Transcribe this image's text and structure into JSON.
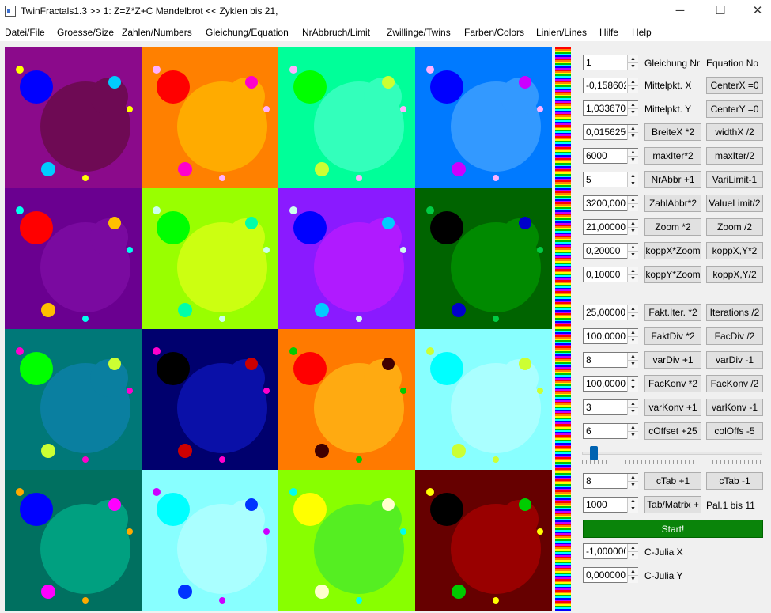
{
  "window": {
    "title": "TwinFractals1.3 >> 1: Z=Z*Z+C Mandelbrot << Zyklen bis 21,",
    "minimize_glyph": "─",
    "maximize_glyph": "☐",
    "close_glyph": "✕"
  },
  "menu": [
    "Datei/File",
    "Groesse/Size",
    "Zahlen/Numbers",
    "Gleichung/Equation",
    "NrAbbruch/Limit",
    "Zwillinge/Twins",
    "Farben/Colors",
    "Linien/Lines",
    "Hilfe",
    "Help"
  ],
  "tiles": [
    {
      "bg": "#8b0a8b",
      "body": "#6e0a54",
      "big": "#0000ff",
      "c1": "#ffff00",
      "c2": "#00ccff",
      "c3": "#00ccff",
      "c4": "#ffff00"
    },
    {
      "bg": "#ff8000",
      "body": "#ffab00",
      "big": "#ff0000",
      "c1": "#ffb0ff",
      "c2": "#ff00cc",
      "c3": "#ff00cc",
      "c4": "#ffb0ff"
    },
    {
      "bg": "#00ff99",
      "body": "#33ffbb",
      "big": "#00ff00",
      "c1": "#ffb0ff",
      "c2": "#ccff33",
      "c3": "#ccff33",
      "c4": "#ffb0ff"
    },
    {
      "bg": "#007aff",
      "body": "#3399ff",
      "big": "#0000ff",
      "c1": "#ffb0ff",
      "c2": "#cc00ff",
      "c3": "#cc00ff",
      "c4": "#ffb0ff"
    },
    {
      "bg": "#6a0090",
      "body": "#7a0aa0",
      "big": "#ff0000",
      "c1": "#00ffee",
      "c2": "#ffbf00",
      "c3": "#ffbf00",
      "c4": "#00ffee"
    },
    {
      "bg": "#99ff00",
      "body": "#ccff11",
      "big": "#00ff00",
      "c1": "#ccffee",
      "c2": "#00ffaa",
      "c3": "#00ffaa",
      "c4": "#ccffee"
    },
    {
      "bg": "#8a1aff",
      "body": "#b01aff",
      "big": "#0000ff",
      "c1": "#ccffee",
      "c2": "#00ccff",
      "c3": "#00ccff",
      "c4": "#ccffee"
    },
    {
      "bg": "#006400",
      "body": "#008a00",
      "big": "#000000",
      "c1": "#00cc44",
      "c2": "#0000cc",
      "c3": "#0000cc",
      "c4": "#00cc44"
    },
    {
      "bg": "#007878",
      "body": "#0a7fa0",
      "big": "#00ff00",
      "c1": "#ff00cc",
      "c2": "#ccff33",
      "c3": "#ccff33",
      "c4": "#ff00cc"
    },
    {
      "bg": "#00006e",
      "body": "#0a10a8",
      "big": "#000000",
      "c1": "#ff00cc",
      "c2": "#cc0000",
      "c3": "#cc0000",
      "c4": "#ff00cc"
    },
    {
      "bg": "#ff7a00",
      "body": "#ffaa11",
      "big": "#ff0000",
      "c1": "#00cc00",
      "c2": "#400000",
      "c3": "#400000",
      "c4": "#00cc00"
    },
    {
      "bg": "#88ffff",
      "body": "#aaffff",
      "big": "#00ffff",
      "c1": "#ccff33",
      "c2": "#ccff33",
      "c3": "#ccff33",
      "c4": "#ccff33"
    },
    {
      "bg": "#007060",
      "body": "#00a080",
      "big": "#0000ff",
      "c1": "#ffaa00",
      "c2": "#ff00ff",
      "c3": "#ff00ff",
      "c4": "#ffaa00"
    },
    {
      "bg": "#88ffff",
      "body": "#aaffff",
      "big": "#00ffff",
      "c1": "#cc00ff",
      "c2": "#0033ff",
      "c3": "#0033ff",
      "c4": "#cc00ff"
    },
    {
      "bg": "#88ff00",
      "body": "#55ee22",
      "big": "#ffff00",
      "c1": "#00ffee",
      "c2": "#ffffcc",
      "c3": "#ffffcc",
      "c4": "#00ffee"
    },
    {
      "bg": "#660000",
      "body": "#990000",
      "big": "#000000",
      "c1": "#ffff00",
      "c2": "#00cc00",
      "c3": "#00cc00",
      "c4": "#ffff00"
    }
  ],
  "panel": {
    "equation_nr": {
      "value": "1",
      "label": "Gleichung Nr",
      "button": "Equation No"
    },
    "center_x": {
      "value": "-0,158602(",
      "label": "Mittelpkt. X",
      "button": "CenterX =0"
    },
    "center_y": {
      "value": "1,0336700",
      "label": "Mittelpkt. Y",
      "button": "CenterY =0"
    },
    "width_x": {
      "value": "0,0156250",
      "btn_double": "BreiteX *2",
      "btn_half": "widthX /2"
    },
    "max_iter": {
      "value": "6000",
      "btn_double": "maxIter*2",
      "btn_half": "maxIter/2"
    },
    "nr_abbr": {
      "value": "5",
      "btn_plus": "NrAbbr +1",
      "btn_minus": "VariLimit-1"
    },
    "zahl_abbr": {
      "value": "3200,0000",
      "btn_double": "ZahlAbbr*2",
      "btn_half": "ValueLimit/2"
    },
    "zoom": {
      "value": "21,000000",
      "btn_double": "Zoom *2",
      "btn_half": "Zoom /2"
    },
    "kopp_x": {
      "value": "0,20000",
      "btn_double": "koppX*Zoom",
      "btn_half": "koppX,Y*2"
    },
    "kopp_y": {
      "value": "0,10000",
      "btn_double": "koppY*Zoom",
      "btn_half": "koppX,Y/2"
    },
    "fakt_iter": {
      "value": "25,00000",
      "btn_double": "Fakt.Iter. *2",
      "btn_half": "Iterations /2"
    },
    "fakt_div": {
      "value": "100,00000",
      "btn_double": "FaktDiv *2",
      "btn_half": "FacDiv /2"
    },
    "var_div": {
      "value": "8",
      "btn_plus": "varDiv +1",
      "btn_minus": "varDiv -1"
    },
    "fac_konv": {
      "value": "100,00000",
      "btn_double": "FacKonv *2",
      "btn_half": "FacKonv /2"
    },
    "var_konv": {
      "value": "3",
      "btn_plus": "varKonv +1",
      "btn_minus": "varKonv -1"
    },
    "c_offset": {
      "value": "6",
      "btn_plus": "cOffset +25",
      "btn_minus": "colOffs -5"
    },
    "slider_fraction": 0.03,
    "c_tab": {
      "value": "8",
      "btn_plus": "cTab +1",
      "btn_minus": "cTab -1"
    },
    "tab_matrix": {
      "value": "1000",
      "button": "Tab/Matrix +",
      "label": "Pal.1 bis 11"
    },
    "start": "Start!",
    "c_julia_x": {
      "value": "-1,000000(",
      "label": "C-Julia X"
    },
    "c_julia_y": {
      "value": "0,0000000",
      "label": "C-Julia Y"
    }
  }
}
